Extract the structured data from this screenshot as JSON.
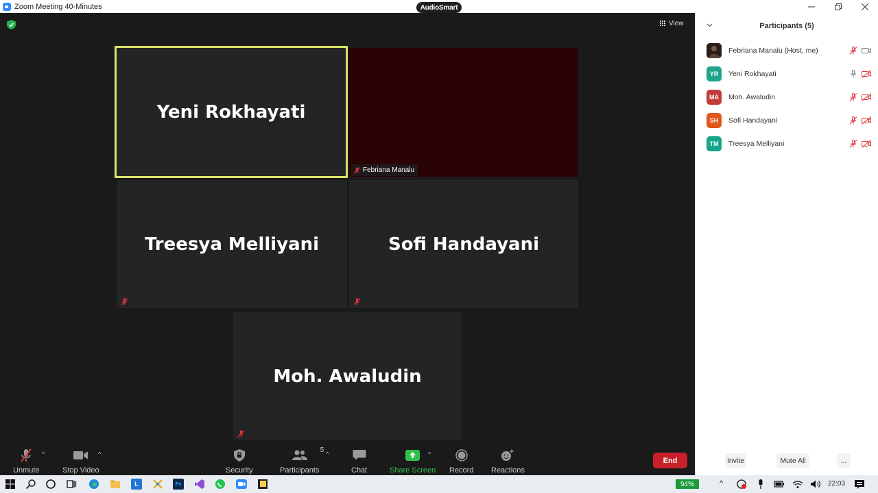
{
  "window": {
    "title": "Zoom Meeting 40-Minutes",
    "badge": "AudioSmart",
    "controls": [
      "minimize",
      "restore",
      "close"
    ]
  },
  "meeting": {
    "view_label": "View",
    "tiles": [
      {
        "name": "Yeni Rokhayati",
        "active": true
      },
      {
        "name": "Febriana Manalu",
        "video": true
      },
      {
        "name": "Treesya Melliyani"
      },
      {
        "name": "Sofi Handayani"
      },
      {
        "name": "Moh. Awaludin"
      }
    ]
  },
  "toolbar": {
    "unmute": "Unmute",
    "stop_video": "Stop Video",
    "security": "Security",
    "participants": "Participants",
    "participants_count": "5",
    "chat": "Chat",
    "share_screen": "Share Screen",
    "record": "Record",
    "reactions": "Reactions",
    "end": "End"
  },
  "panel": {
    "title": "Participants (5)",
    "participants": [
      {
        "name": "Febriana Manalu (Host, me)",
        "initials": "",
        "color": "#3a2a22",
        "mic": "muted",
        "cam": "on"
      },
      {
        "name": "Yeni Rokhayati",
        "initials": "YR",
        "color": "#1fa58e",
        "mic": "on",
        "cam": "off"
      },
      {
        "name": "Moh. Awaludin",
        "initials": "MA",
        "color": "#c43b3b",
        "mic": "muted",
        "cam": "off"
      },
      {
        "name": "Sofi Handayani",
        "initials": "SH",
        "color": "#e0561b",
        "mic": "muted",
        "cam": "off"
      },
      {
        "name": "Treesya Melliyani",
        "initials": "TM",
        "color": "#17a58b",
        "mic": "muted",
        "cam": "off"
      }
    ],
    "invite": "Invite",
    "mute_all": "Mute All",
    "more": "..."
  },
  "taskbar": {
    "battery": "94%",
    "time": "22:03",
    "apps": [
      "windows",
      "search",
      "cortana",
      "task-view",
      "edge",
      "file-explorer",
      "L",
      "app-x",
      "photoshop",
      "visual-studio",
      "whatsapp",
      "zoom",
      "sticky"
    ]
  },
  "colors": {
    "active_border": "#d8e36a",
    "end_button": "#c8202a",
    "share_green": "#2fc24a"
  }
}
